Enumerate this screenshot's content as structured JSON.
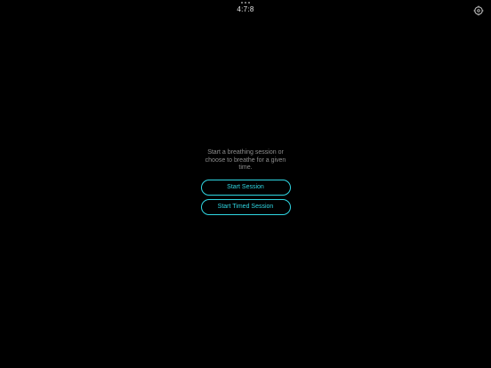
{
  "header": {
    "title": "4:7:8"
  },
  "main": {
    "intro_text": "Start a breathing session or choose to breathe for a given time.",
    "start_session_label": "Start Session",
    "start_timed_session_label": "Start Timed Session"
  },
  "icons": {
    "settings": "settings-icon",
    "menu_dots": "more-dots-icon"
  },
  "colors": {
    "background": "#000000",
    "accent": "#2fd6e2",
    "text_secondary": "#8e8e8e",
    "title_text": "#e6e6e6"
  }
}
